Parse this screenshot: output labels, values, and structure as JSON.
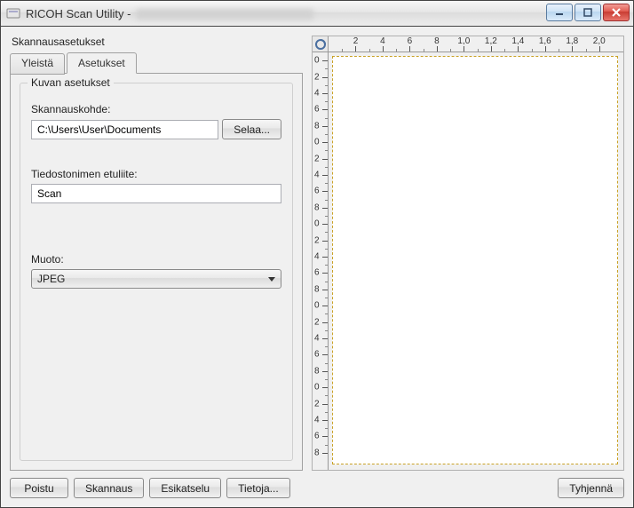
{
  "window": {
    "title_prefix": "RICOH Scan Utility - "
  },
  "section_label": "Skannausasetukset",
  "tabs": {
    "general": "Yleistä",
    "settings": "Asetukset"
  },
  "group": {
    "legend": "Kuvan asetukset",
    "scan_target_label": "Skannauskohde:",
    "scan_target_value": "C:\\Users\\User\\Documents",
    "browse_label": "Selaa...",
    "prefix_label": "Tiedostonimen etuliite:",
    "prefix_value": "Scan",
    "format_label": "Muoto:",
    "format_value": "JPEG"
  },
  "buttons": {
    "exit": "Poistu",
    "scan": "Skannaus",
    "preview": "Esikatselu",
    "about": "Tietoja...",
    "clear": "Tyhjennä"
  },
  "ruler": {
    "top_labels": [
      "2",
      "4",
      "6",
      "8",
      "1,0",
      "1,2",
      "1,4",
      "1,6",
      "1,8",
      "2,0"
    ],
    "left_labels": [
      "0",
      "2",
      "4",
      "6",
      "8",
      "0",
      "2",
      "4",
      "6",
      "8",
      "0",
      "2",
      "4",
      "6",
      "8",
      "0",
      "2",
      "4",
      "6",
      "8",
      "0",
      "2",
      "4",
      "6",
      "8"
    ]
  }
}
